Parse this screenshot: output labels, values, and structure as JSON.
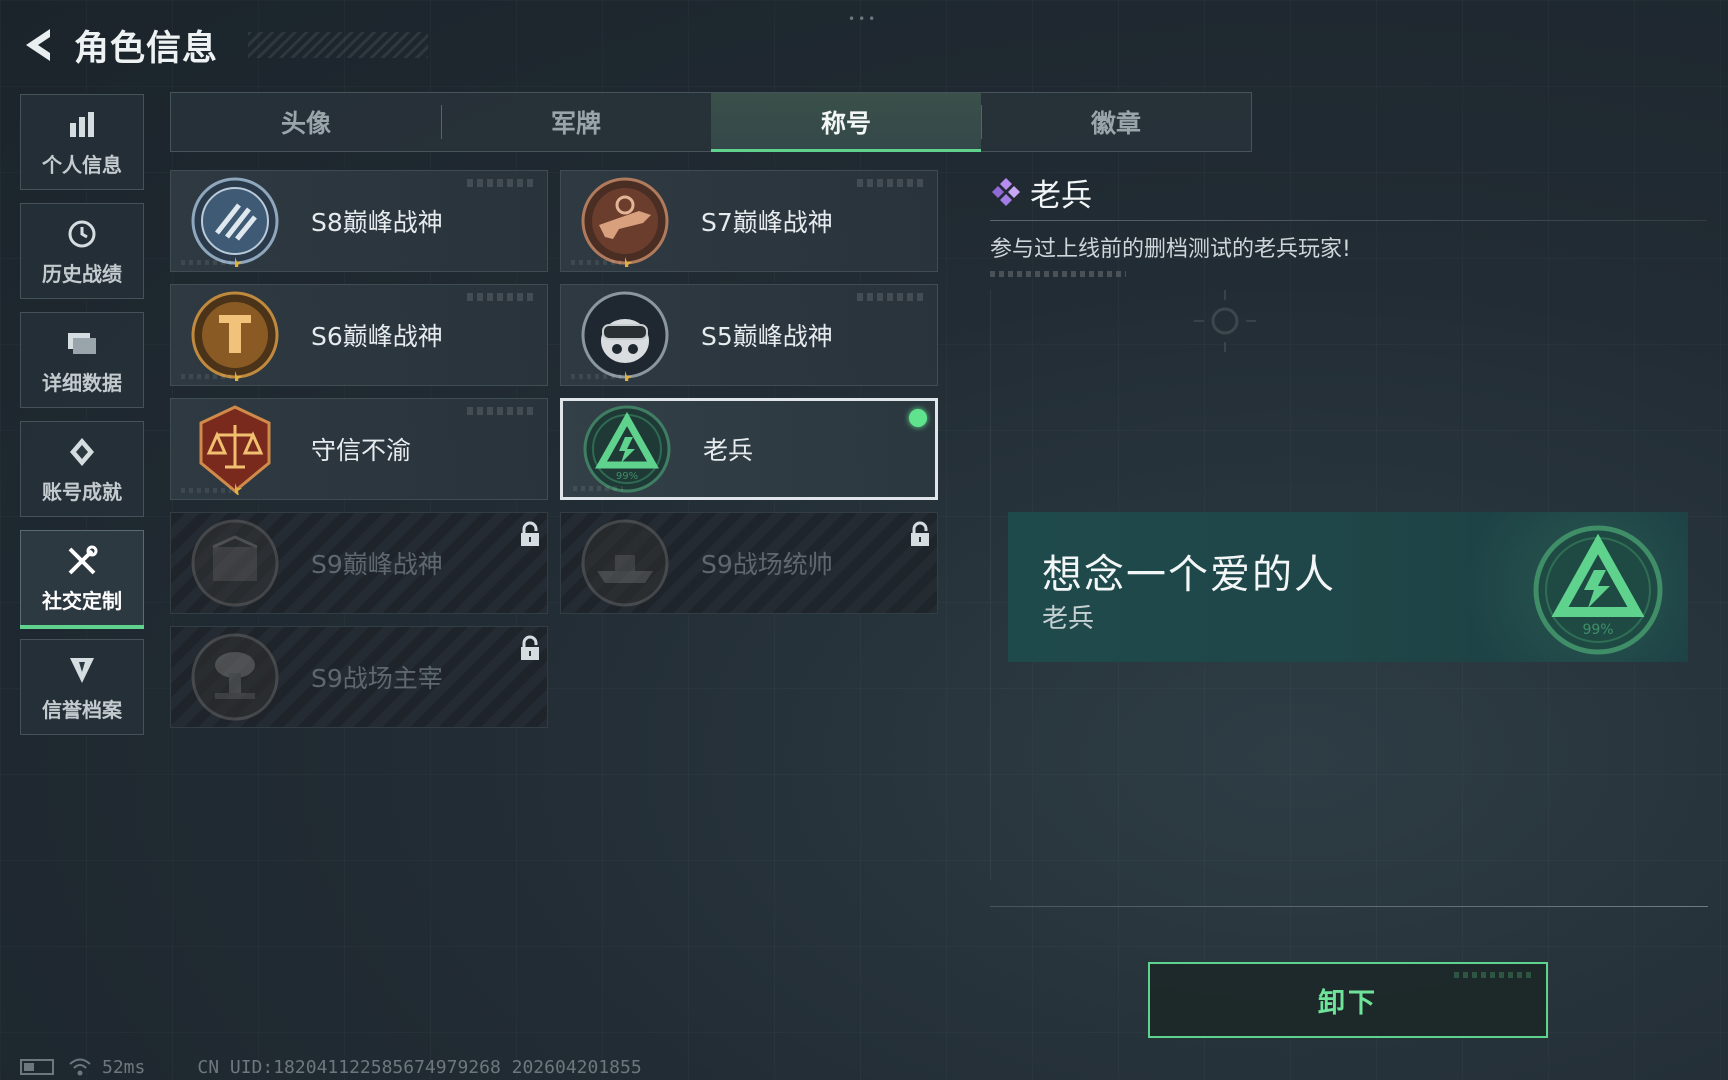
{
  "header": {
    "title": "角色信息"
  },
  "side_nav": [
    {
      "label": "个人信息",
      "icon": "bar-chart-icon"
    },
    {
      "label": "历史战绩",
      "icon": "clock-icon"
    },
    {
      "label": "详细数据",
      "icon": "folder-icon"
    },
    {
      "label": "账号成就",
      "icon": "achievement-icon"
    },
    {
      "label": "社交定制",
      "icon": "tools-icon",
      "active": true
    },
    {
      "label": "信誉档案",
      "icon": "reputation-icon"
    }
  ],
  "tabs": [
    {
      "label": "头像"
    },
    {
      "label": "军牌"
    },
    {
      "label": "称号",
      "active": true
    },
    {
      "label": "徽章"
    }
  ],
  "titles": [
    {
      "label": "S8巅峰战神",
      "medal": "s8-medal-icon",
      "locked": false
    },
    {
      "label": "S7巅峰战神",
      "medal": "s7-medal-icon",
      "locked": false
    },
    {
      "label": "S6巅峰战神",
      "medal": "s6-medal-icon",
      "locked": false
    },
    {
      "label": "S5巅峰战神",
      "medal": "s5-medal-icon",
      "locked": false
    },
    {
      "label": "守信不渝",
      "medal": "scales-medal-icon",
      "locked": false
    },
    {
      "label": "老兵",
      "medal": "veteran-medal-icon",
      "locked": false,
      "selected": true,
      "equipped": true,
      "medal_text": "99%"
    },
    {
      "label": "S9巅峰战神",
      "medal": "s9-medal-icon",
      "locked": true
    },
    {
      "label": "S9战场统帅",
      "medal": "warship-medal-icon",
      "locked": true
    },
    {
      "label": "S9战场主宰",
      "medal": "mushroom-cloud-medal-icon",
      "locked": true
    }
  ],
  "detail": {
    "name": "老兵",
    "description": "参与过上线前的删档测试的老兵玩家!",
    "rarity_color": "#b68cf0"
  },
  "banner": {
    "title": "想念一个爱的人",
    "subtitle": "老兵",
    "emblem_text": "99%"
  },
  "actions": {
    "unequip_label": "卸下"
  },
  "status": {
    "ping": "52ms",
    "uid": "CN UID:18204112258567497926​8 202604201855"
  },
  "colors": {
    "accent": "#5fd38d",
    "background": "#222c34"
  }
}
